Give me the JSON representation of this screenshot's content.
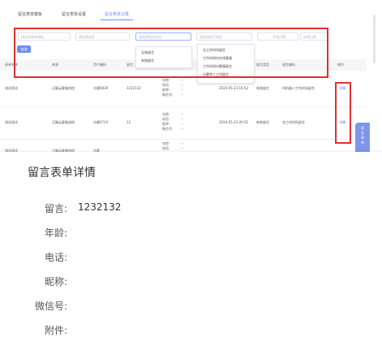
{
  "tabs": [
    {
      "label": "留言表单模板"
    },
    {
      "label": "留言表单设置"
    },
    {
      "label": "留言表单记录"
    }
  ],
  "filters": [
    {
      "placeholder": "请选择表单模板"
    },
    {
      "placeholder": "请选择是否"
    },
    {
      "placeholder": "请选择留言状态"
    },
    {
      "placeholder": "请选择留言类型"
    },
    {
      "placeholder": "开始日期"
    },
    {
      "placeholder": "结束日期"
    }
  ],
  "search_button": "查询",
  "dropdown_left": [
    "无效留言",
    "有效留言"
  ],
  "dropdown_right": [
    "无工作时间留言",
    "工作时间内在线客服",
    "工作时间内客服留言",
    "访客转人工时留言"
  ],
  "table": {
    "headers": [
      "表单名称",
      "来源",
      "用户编码",
      "留言",
      "",
      "",
      "",
      "创建时间",
      "留言类型",
      "留言编码",
      "操作"
    ],
    "rows": [
      {
        "name": "测试测试",
        "source": "正确云客服流程",
        "user_code": "访客6839",
        "message": "1232132",
        "details": [
          {
            "k": "年龄:",
            "v": "--"
          },
          {
            "k": "电话:",
            "v": "--"
          },
          {
            "k": "昵称:",
            "v": "--"
          },
          {
            "k": "微信号:",
            "v": "--"
          }
        ],
        "time": "2024-05-23 16:52",
        "type": "有效留言",
        "code": "AI机器人工作时间留言",
        "action": "详情"
      },
      {
        "name": "测试测试",
        "source": "正确云客服流程",
        "user_code": "访客6724",
        "message": "12",
        "details": [
          {
            "k": "年龄:",
            "v": "--"
          },
          {
            "k": "电话:",
            "v": "--"
          },
          {
            "k": "昵称:",
            "v": "--"
          },
          {
            "k": "微信号:",
            "v": "--"
          }
        ],
        "time": "2024-05-23 00:32",
        "type": "有效留言",
        "code": "非工作时间留言",
        "action": "详情"
      },
      {
        "name": "测试测试",
        "source": "正确云客服流程",
        "user_code": "访客",
        "message": "",
        "details": [
          {
            "k": "年龄:",
            "v": "--"
          },
          {
            "k": "电话:",
            "v": "--"
          }
        ],
        "time": "",
        "type": "",
        "code": "",
        "action": ""
      }
    ]
  },
  "float_tab": [
    "收",
    "发",
    "表",
    "单"
  ],
  "modal": {
    "title": "留言表单详情",
    "fields": [
      {
        "label": "留言:",
        "value": "1232132"
      },
      {
        "label": "年龄:",
        "value": ""
      },
      {
        "label": "电话:",
        "value": ""
      },
      {
        "label": "昵称:",
        "value": ""
      },
      {
        "label": "微信号:",
        "value": ""
      },
      {
        "label": "附件:",
        "value": ""
      }
    ]
  },
  "colors": {
    "accent": "#6c8cff",
    "highlight_border": "#e03030",
    "float_tab": "#7f95ea"
  }
}
